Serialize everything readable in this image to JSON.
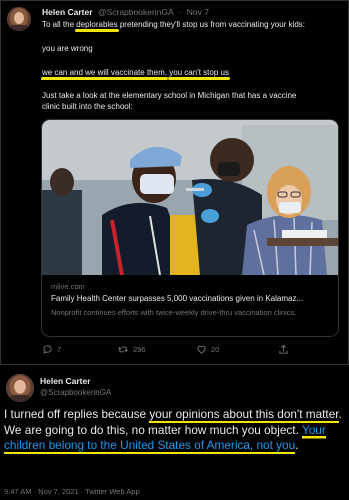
{
  "tweet1": {
    "author_name": "Helen Carter",
    "handle": "@ScrapbookerinGA",
    "date": "Nov 7",
    "text_line1_pre": "To all the ",
    "text_line1_hl": "deplorables",
    "text_line1_post": " pretending they'll stop us from vaccinating your kids:",
    "text_line2": "you are wrong",
    "text_line3_hl1": "we can and we will vaccinate them,",
    "text_line3_hl2": "you can't stop us",
    "text_line4": "Just take a look at the elementary school in Michigan that has a vaccine",
    "text_line5": "clinic built into the school:",
    "card": {
      "domain": "mlive.com",
      "title": "Family Health Center surpasses 5,000 vaccinations given in Kalamaz...",
      "description": "Nonprofit continues efforts with twice-weekly drive-thru vaccination clinics."
    },
    "actions": {
      "replies": "7",
      "retweets": "296",
      "likes": "20"
    }
  },
  "tweet2": {
    "author_name": "Helen Carter",
    "handle": "@ScrapbookerinGA",
    "body_a": "I turned off replies because ",
    "body_hl1": "your opinions about this don't matter",
    "body_b": ". We are going to do this, no matter how much you object. ",
    "body_hl2": "Your children belong to the United States of America, not you",
    "body_c": ".",
    "timestamp": "9:47 AM · Nov 7, 2021 · Twitter Web App"
  },
  "colors": {
    "background": "#000000",
    "text": "#e7e9ea",
    "muted": "#71767b",
    "link": "#1d9bf0",
    "highlight": "#f2e600"
  }
}
